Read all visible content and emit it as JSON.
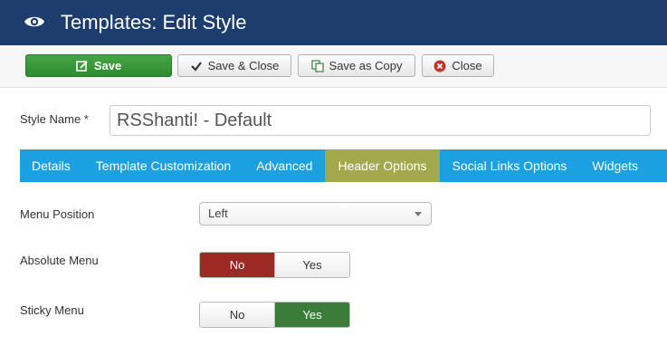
{
  "header": {
    "title": "Templates: Edit Style",
    "icon": "eye-icon",
    "bg_color": "#1c3d6e"
  },
  "toolbar": {
    "save_label": "Save",
    "save_close_label": "Save & Close",
    "save_as_copy_label": "Save as Copy",
    "close_label": "Close",
    "save_color": "#3e9b3e"
  },
  "form": {
    "style_name_label": "Style Name *",
    "style_name_value": "RSShanti! - Default"
  },
  "tabs": [
    {
      "label": "Details"
    },
    {
      "label": "Template Customization"
    },
    {
      "label": "Advanced"
    },
    {
      "label": "Header Options"
    },
    {
      "label": "Social Links Options"
    },
    {
      "label": "Widgets"
    }
  ],
  "active_tab": "Header Options",
  "fields": {
    "menu_position": {
      "label": "Menu Position",
      "value": "Left"
    },
    "absolute_menu": {
      "label": "Absolute Menu",
      "no": "No",
      "yes": "Yes",
      "selected": "No"
    },
    "sticky_menu": {
      "label": "Sticky Menu",
      "no": "No",
      "yes": "Yes",
      "selected": "Yes"
    }
  }
}
